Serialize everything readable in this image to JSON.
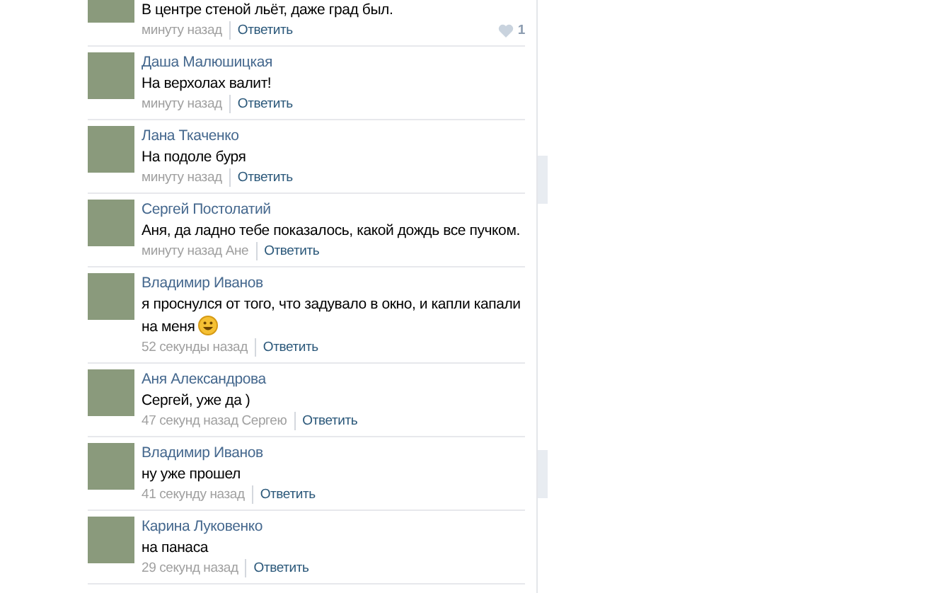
{
  "comments": [
    {
      "text": "В центре стеной льёт, даже град был.",
      "time": "минуту назад",
      "reply": "Ответить",
      "likes": "1",
      "emoji": false
    },
    {
      "author": "Даша Малюшицкая",
      "text": "На верхолах валит!",
      "time": "минуту назад",
      "reply": "Ответить",
      "emoji": false
    },
    {
      "author": "Лана Ткаченко",
      "text": "На подоле буря",
      "time": "минуту назад",
      "reply": "Ответить",
      "emoji": false
    },
    {
      "author": "Сергей Постолатий",
      "text": "Аня, да ладно тебе показалось, какой дождь все пучком.",
      "time": "минуту назад",
      "reply_to": "Ане",
      "reply": "Ответить",
      "emoji": false
    },
    {
      "author": "Владимир Иванов",
      "text": "я проснулся от того, что задувало в окно, и капли капали на меня",
      "time": "52 секунды назад",
      "reply": "Ответить",
      "emoji": true
    },
    {
      "author": "Аня Александрова",
      "text": "Сергей, уже да )",
      "time": "47 секунд назад",
      "reply_to": "Сергею",
      "reply": "Ответить",
      "emoji": false
    },
    {
      "author": "Владимир Иванов",
      "text": "ну уже прошел",
      "time": "41 секунду назад",
      "reply": "Ответить",
      "emoji": false
    },
    {
      "author": "Карина Луковенко",
      "text": "на панаса",
      "time": "29 секунд назад",
      "reply": "Ответить",
      "emoji": false
    }
  ]
}
